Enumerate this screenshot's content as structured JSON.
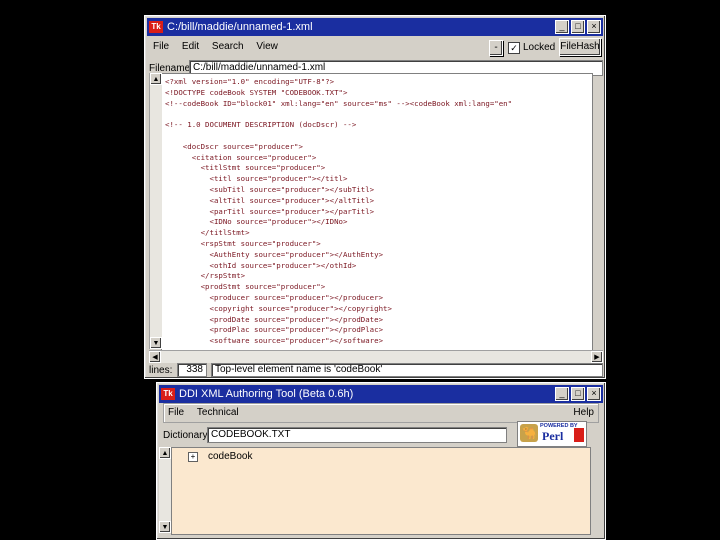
{
  "editor": {
    "title": "C:/bill/maddie/unnamed-1.xml",
    "menu": [
      "File",
      "Edit",
      "Search",
      "View"
    ],
    "locked_label": "Locked",
    "locked_checked": true,
    "file_hash_button": "FileHash",
    "filename_label": "Filename:",
    "filename_value": "C:/bill/maddie/unnamed-1.xml",
    "code_lines": [
      "<?xml version=\"1.0\" encoding=\"UTF-8\"?>",
      "<!DOCTYPE codeBook SYSTEM \"CODEBOOK.TXT\">",
      "<!--codeBook ID=\"block01\" xml:lang=\"en\" source=\"ms\" --><codeBook xml:lang=\"en\"",
      "",
      "<!-- 1.0 DOCUMENT DESCRIPTION (docDscr) -->",
      "",
      "    <docDscr source=\"producer\">",
      "      <citation source=\"producer\">",
      "        <titlStmt source=\"producer\">",
      "          <titl source=\"producer\"></titl>",
      "          <subTitl source=\"producer\"></subTitl>",
      "          <altTitl source=\"producer\"></altTitl>",
      "          <parTitl source=\"producer\"></parTitl>",
      "          <IDNo source=\"producer\"></IDNo>",
      "        </titlStmt>",
      "        <rspStmt source=\"producer\">",
      "          <AuthEnty source=\"producer\"></AuthEnty>",
      "          <othId source=\"producer\"></othId>",
      "        </rspStmt>",
      "        <prodStmt source=\"producer\">",
      "          <producer source=\"producer\"></producer>",
      "          <copyright source=\"producer\"></copyright>",
      "          <prodDate source=\"producer\"></prodDate>",
      "          <prodPlac source=\"producer\"></prodPlac>",
      "          <software source=\"producer\"></software>"
    ],
    "lines_label": "lines:",
    "lines_value": "338",
    "status_text": "Top-level element name is 'codeBook'"
  },
  "authoring": {
    "title": "DDI XML Authoring Tool (Beta 0.6h)",
    "menu": [
      "File",
      "Technical"
    ],
    "help_label": "Help",
    "dictionary_label": "Dictionary:",
    "dictionary_value": "CODEBOOK.TXT",
    "perl_badge_top": "POWERED BY",
    "perl_badge_text": "Perl",
    "tree_expander": "+",
    "tree_root": "codeBook"
  },
  "colors": {
    "titlebar": "#1a2ea0",
    "code_text": "#7a1520",
    "tree_bg": "#fbe8cf"
  }
}
